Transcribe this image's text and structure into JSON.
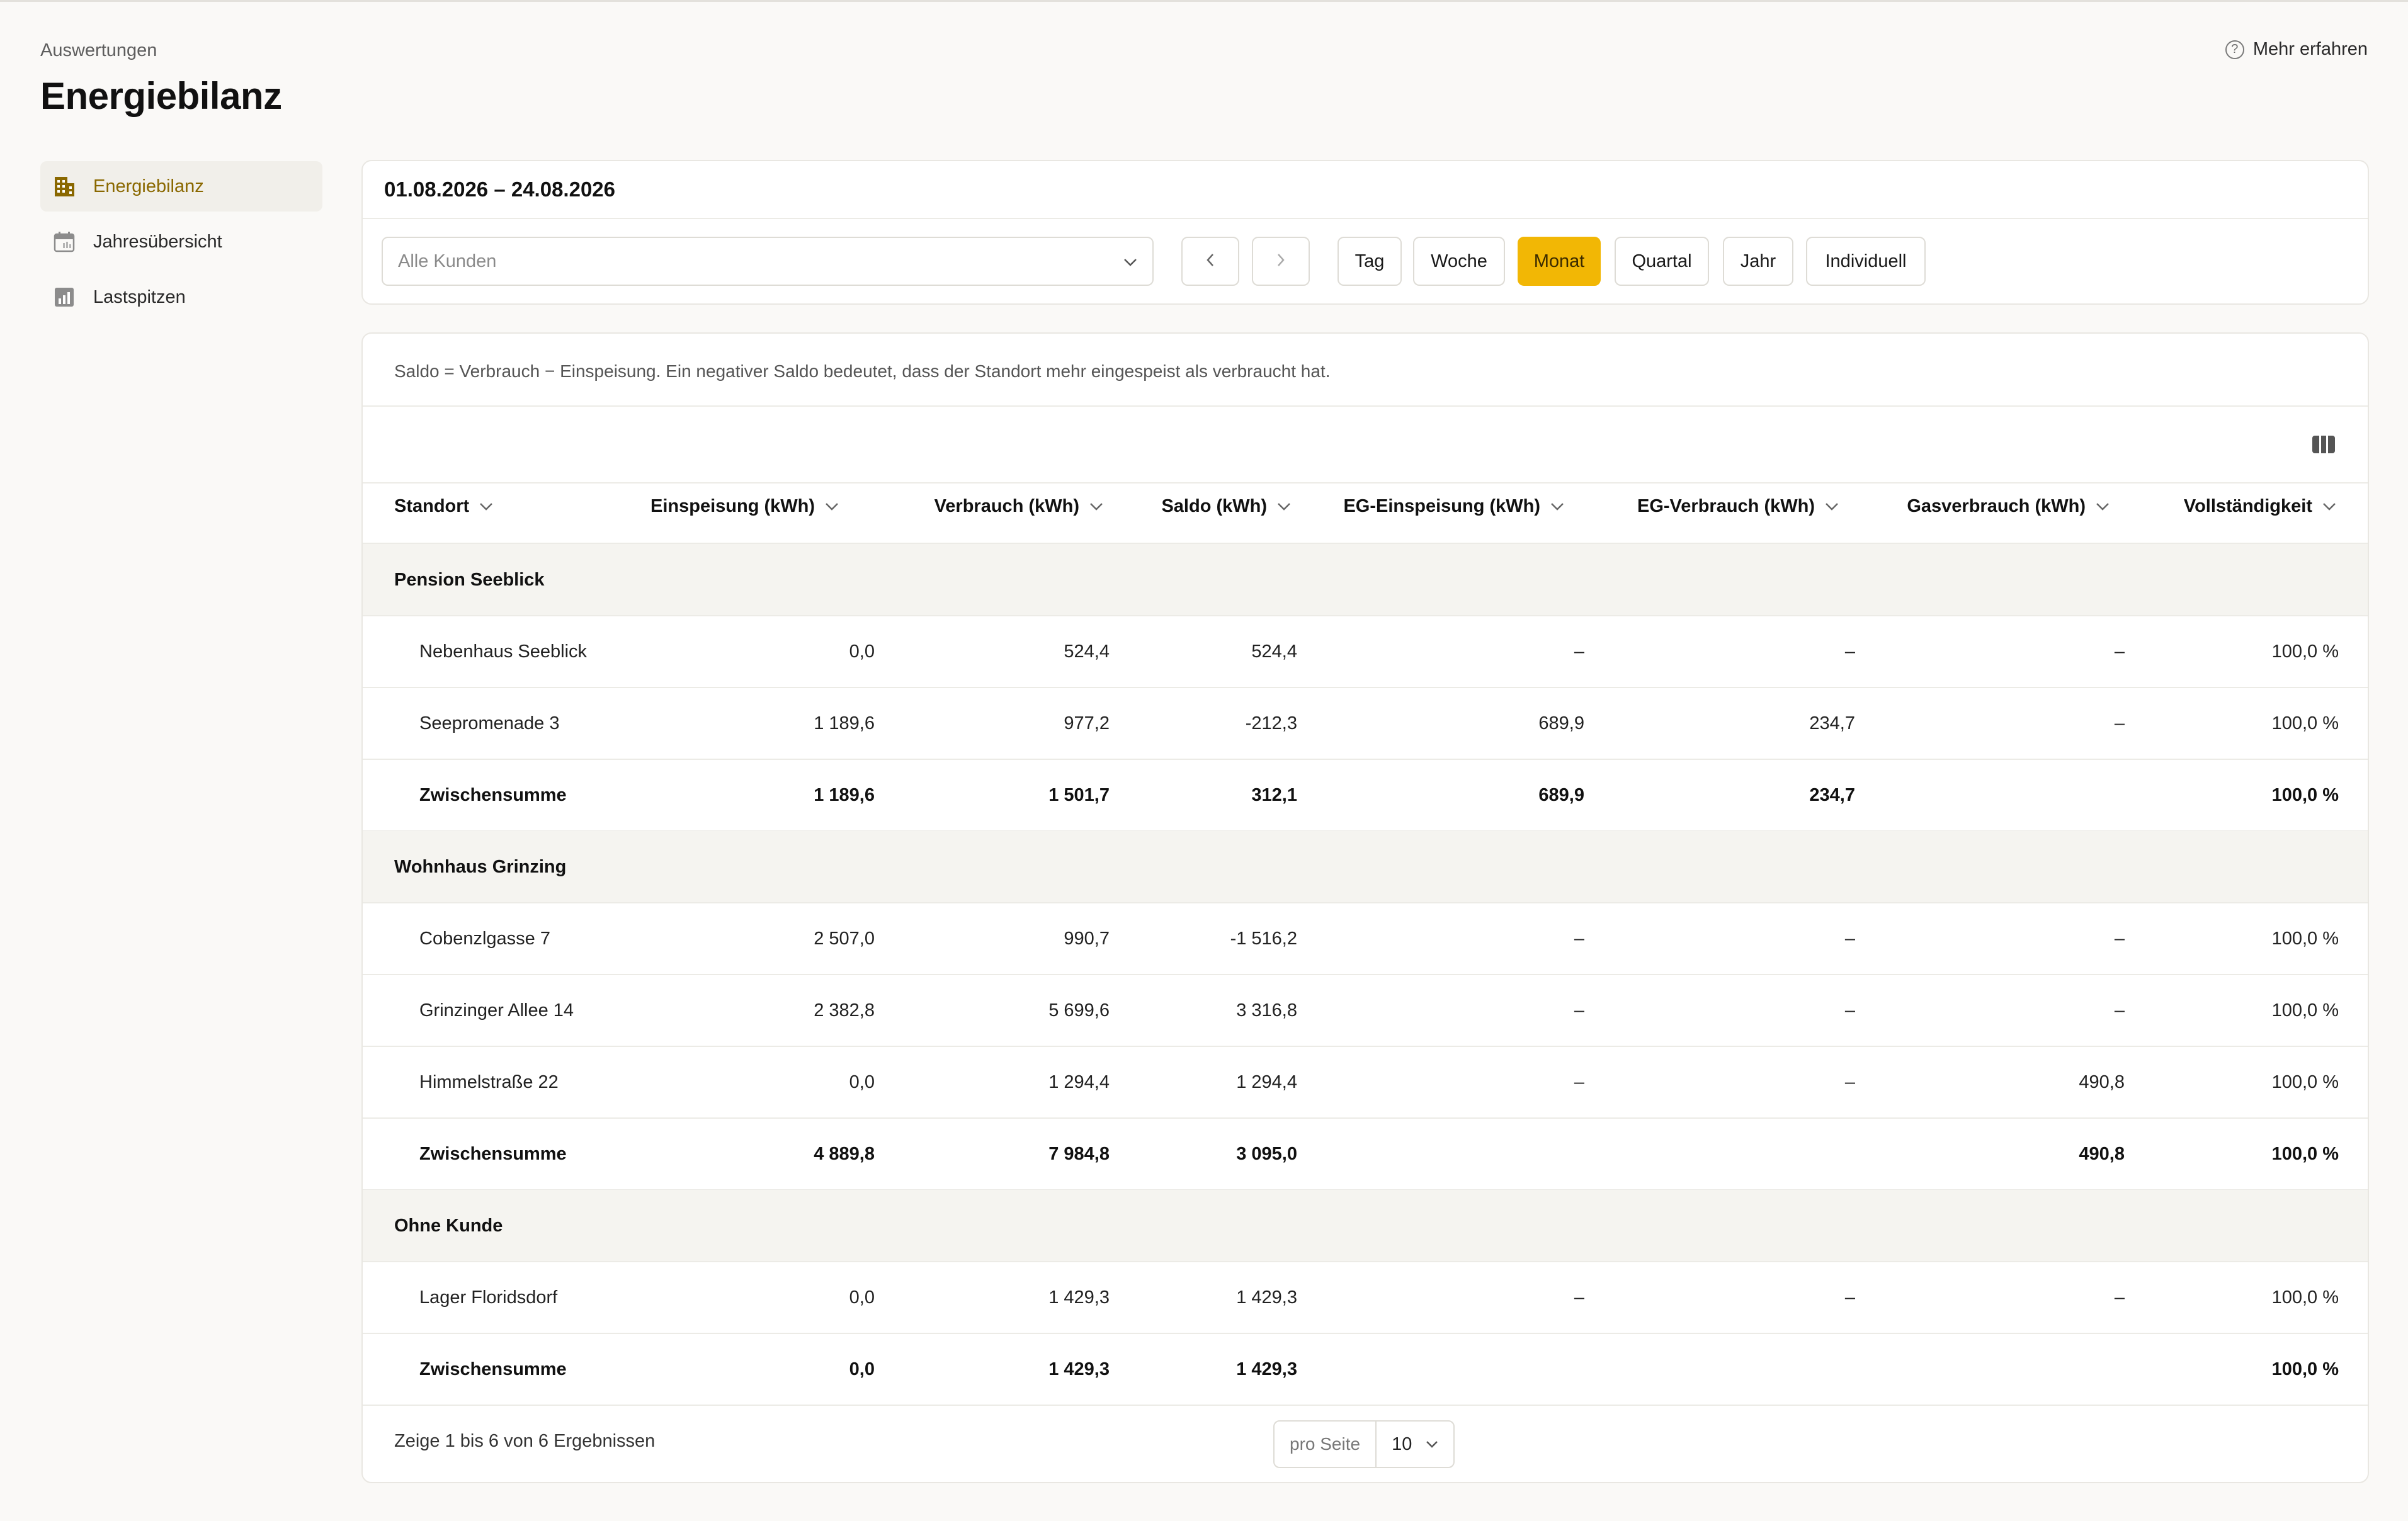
{
  "header": {
    "breadcrumb": "Auswertungen",
    "title": "Energiebilanz",
    "learn_more": "Mehr erfahren"
  },
  "sidebar": {
    "items": [
      {
        "label": "Energiebilanz",
        "icon": "building-icon",
        "active": true
      },
      {
        "label": "Jahresübersicht",
        "icon": "calendar-icon",
        "active": false
      },
      {
        "label": "Lastspitzen",
        "icon": "bar-chart-icon",
        "active": false
      }
    ]
  },
  "filters": {
    "date_range": "01.08.2026 – 24.08.2026",
    "customer_placeholder": "Alle Kunden",
    "periods": [
      "Tag",
      "Woche",
      "Monat",
      "Quartal",
      "Jahr",
      "Individuell"
    ],
    "active_period": "Monat"
  },
  "table": {
    "note": "Saldo = Verbrauch − Einspeisung. Ein negativer Saldo bedeutet, dass der Standort mehr eingespeist als verbraucht hat.",
    "columns": [
      "Standort",
      "Einspeisung (kWh)",
      "Verbrauch (kWh)",
      "Saldo (kWh)",
      "EG-Einspeisung (kWh)",
      "EG-Verbrauch (kWh)",
      "Gasverbrauch (kWh)",
      "Vollständigkeit"
    ],
    "groups": [
      {
        "name": "Pension Seeblick",
        "rows": [
          [
            "Nebenhaus Seeblick",
            "0,0",
            "524,4",
            "524,4",
            "–",
            "–",
            "–",
            "100,0 %"
          ],
          [
            "Seepromenade 3",
            "1 189,6",
            "977,2",
            "-212,3",
            "689,9",
            "234,7",
            "–",
            "100,0 %"
          ]
        ],
        "subtotal": [
          "Zwischensumme",
          "1 189,6",
          "1 501,7",
          "312,1",
          "689,9",
          "234,7",
          "",
          "100,0 %"
        ]
      },
      {
        "name": "Wohnhaus Grinzing",
        "rows": [
          [
            "Cobenzlgasse 7",
            "2 507,0",
            "990,7",
            "-1 516,2",
            "–",
            "–",
            "–",
            "100,0 %"
          ],
          [
            "Grinzinger Allee 14",
            "2 382,8",
            "5 699,6",
            "3 316,8",
            "–",
            "–",
            "–",
            "100,0 %"
          ],
          [
            "Himmelstraße 22",
            "0,0",
            "1 294,4",
            "1 294,4",
            "–",
            "–",
            "490,8",
            "100,0 %"
          ]
        ],
        "subtotal": [
          "Zwischensumme",
          "4 889,8",
          "7 984,8",
          "3 095,0",
          "",
          "",
          "490,8",
          "100,0 %"
        ]
      },
      {
        "name": "Ohne Kunde",
        "rows": [
          [
            "Lager Floridsdorf",
            "0,0",
            "1 429,3",
            "1 429,3",
            "–",
            "–",
            "–",
            "100,0 %"
          ]
        ],
        "subtotal": [
          "Zwischensumme",
          "0,0",
          "1 429,3",
          "1 429,3",
          "",
          "",
          "",
          "100,0 %"
        ]
      }
    ],
    "footer_text": "Zeige 1 bis 6 von 6 Ergebnissen",
    "per_page_label": "pro Seite",
    "per_page_value": "10"
  },
  "colors": {
    "accent": "#f2b705",
    "active_nav_text": "#8a6800",
    "group_row_bg": "#f5f4f0"
  }
}
